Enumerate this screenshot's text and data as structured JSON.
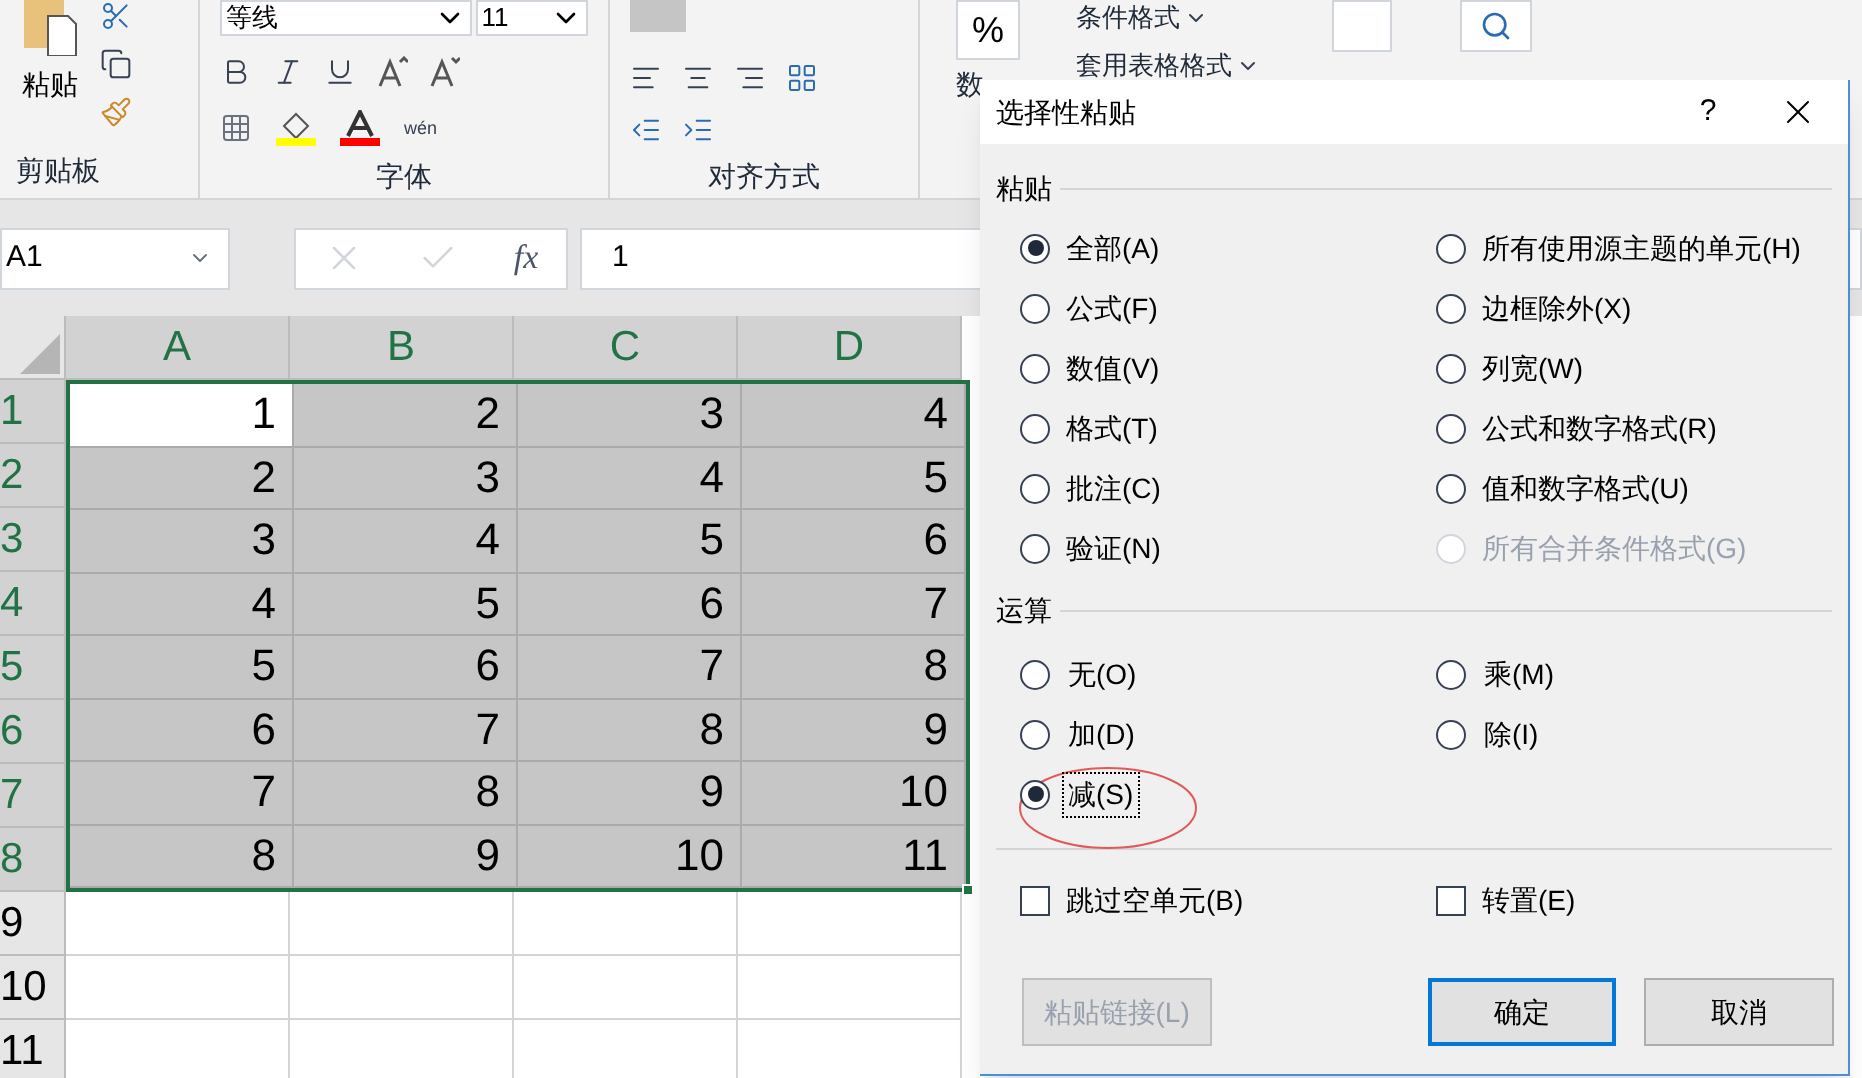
{
  "ribbon": {
    "clipboard": {
      "paste_label": "粘贴",
      "label": "剪贴板"
    },
    "font": {
      "font_name": "等线",
      "font_size": "11",
      "label": "字体",
      "wen_label": "wén"
    },
    "alignment": {
      "label": "对齐方式"
    },
    "number": {
      "percent": "%",
      "label": "数"
    },
    "styles": {
      "items": [
        "条件格式",
        "套用表格格式"
      ]
    }
  },
  "formula_bar": {
    "name_box": "A1",
    "fx_label": "fx",
    "formula": "1"
  },
  "grid": {
    "columns": [
      "A",
      "B",
      "C",
      "D"
    ],
    "rows": [
      {
        "header": "1",
        "selected": true,
        "cells": [
          {
            "value": "1",
            "active": true
          },
          {
            "value": "2",
            "active": false
          },
          {
            "value": "3",
            "active": false
          },
          {
            "value": "4",
            "active": false
          }
        ]
      },
      {
        "header": "2",
        "selected": true,
        "cells": [
          {
            "value": "2",
            "active": false
          },
          {
            "value": "3",
            "active": false
          },
          {
            "value": "4",
            "active": false
          },
          {
            "value": "5",
            "active": false
          }
        ]
      },
      {
        "header": "3",
        "selected": true,
        "cells": [
          {
            "value": "3",
            "active": false
          },
          {
            "value": "4",
            "active": false
          },
          {
            "value": "5",
            "active": false
          },
          {
            "value": "6",
            "active": false
          }
        ]
      },
      {
        "header": "4",
        "selected": true,
        "cells": [
          {
            "value": "4",
            "active": false
          },
          {
            "value": "5",
            "active": false
          },
          {
            "value": "6",
            "active": false
          },
          {
            "value": "7",
            "active": false
          }
        ]
      },
      {
        "header": "5",
        "selected": true,
        "cells": [
          {
            "value": "5",
            "active": false
          },
          {
            "value": "6",
            "active": false
          },
          {
            "value": "7",
            "active": false
          },
          {
            "value": "8",
            "active": false
          }
        ]
      },
      {
        "header": "6",
        "selected": true,
        "cells": [
          {
            "value": "6",
            "active": false
          },
          {
            "value": "7",
            "active": false
          },
          {
            "value": "8",
            "active": false
          },
          {
            "value": "9",
            "active": false
          }
        ]
      },
      {
        "header": "7",
        "selected": true,
        "cells": [
          {
            "value": "7",
            "active": false
          },
          {
            "value": "8",
            "active": false
          },
          {
            "value": "9",
            "active": false
          },
          {
            "value": "10",
            "active": false
          }
        ]
      },
      {
        "header": "8",
        "selected": true,
        "cells": [
          {
            "value": "8",
            "active": false
          },
          {
            "value": "9",
            "active": false
          },
          {
            "value": "10",
            "active": false
          },
          {
            "value": "11",
            "active": false
          }
        ]
      },
      {
        "header": "9",
        "selected": false
      },
      {
        "header": "10",
        "selected": false
      },
      {
        "header": "11",
        "selected": false
      }
    ]
  },
  "dialog": {
    "title": "选择性粘贴",
    "help": "?",
    "paste": {
      "label": "粘贴",
      "options": [
        {
          "label": "全部(A)",
          "selected": true,
          "disabled": false
        },
        {
          "label": "所有使用源主题的单元(H)",
          "selected": false,
          "disabled": false
        },
        {
          "label": "公式(F)",
          "selected": false,
          "disabled": false
        },
        {
          "label": "边框除外(X)",
          "selected": false,
          "disabled": false
        },
        {
          "label": "数值(V)",
          "selected": false,
          "disabled": false
        },
        {
          "label": "列宽(W)",
          "selected": false,
          "disabled": false
        },
        {
          "label": "格式(T)",
          "selected": false,
          "disabled": false
        },
        {
          "label": "公式和数字格式(R)",
          "selected": false,
          "disabled": false
        },
        {
          "label": "批注(C)",
          "selected": false,
          "disabled": false
        },
        {
          "label": "值和数字格式(U)",
          "selected": false,
          "disabled": false
        },
        {
          "label": "验证(N)",
          "selected": false,
          "disabled": false
        },
        {
          "label": "所有合并条件格式(G)",
          "selected": false,
          "disabled": true
        }
      ]
    },
    "operation": {
      "label": "运算",
      "options": [
        {
          "label": "无(O)",
          "selected": false,
          "focused": false
        },
        {
          "label": "乘(M)",
          "selected": false,
          "focused": false
        },
        {
          "label": "加(D)",
          "selected": false,
          "focused": false
        },
        {
          "label": "除(I)",
          "selected": false,
          "focused": false
        },
        {
          "label": "减(S)",
          "selected": true,
          "focused": true
        }
      ]
    },
    "checkboxes": [
      {
        "label": "跳过空单元(B)",
        "checked": false
      },
      {
        "label": "转置(E)",
        "checked": false
      }
    ],
    "buttons": [
      {
        "label": "粘贴链接(L)",
        "disabled": true,
        "default": false
      },
      {
        "label": "确定",
        "disabled": false,
        "default": true
      },
      {
        "label": "取消",
        "disabled": false,
        "default": false
      }
    ]
  }
}
